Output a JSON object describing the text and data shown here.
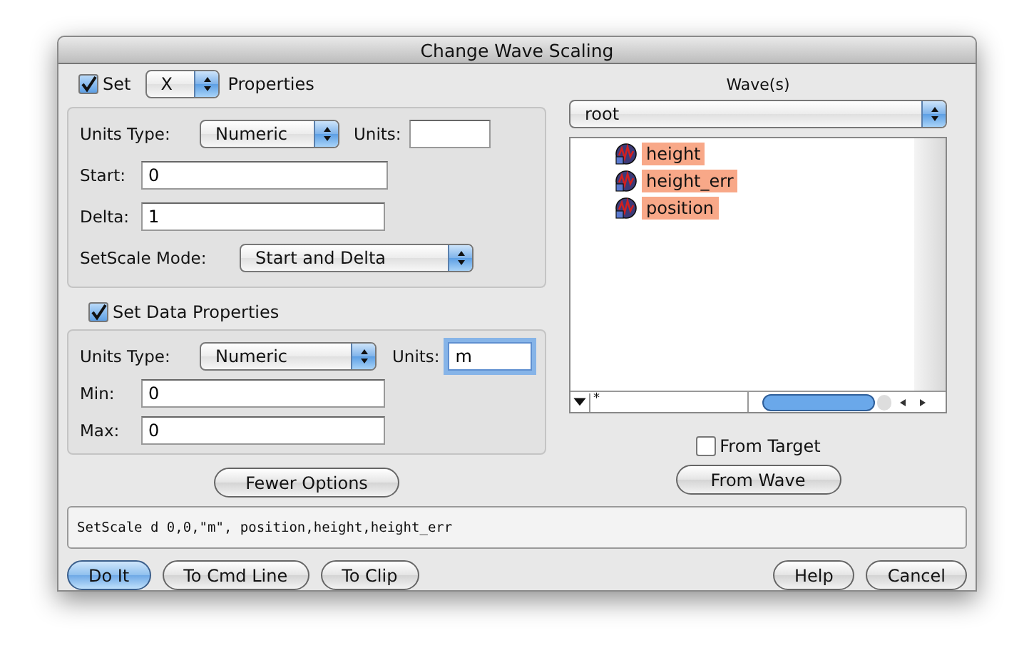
{
  "window": {
    "title": "Change Wave Scaling"
  },
  "axis": {
    "checked": true,
    "label": "Set",
    "axis": "X",
    "suffix": "Properties",
    "units_type_label": "Units Type:",
    "units_type": "Numeric",
    "units_label": "Units:",
    "start_label": "Start:",
    "start": "0",
    "delta_label": "Delta:",
    "delta": "1",
    "mode_label": "SetScale Mode:",
    "mode": "Start and Delta"
  },
  "data": {
    "checked": true,
    "label": "Set Data Properties",
    "units_type_label": "Units Type:",
    "units_type": "Numeric",
    "units_label": "Units:",
    "units": "m",
    "units_focused": true,
    "min_label": "Min:",
    "min": "0",
    "max_label": "Max:",
    "max": "0"
  },
  "fewer_options": "Fewer Options",
  "waves": {
    "label": "Wave(s)",
    "folder": "root",
    "items": [
      {
        "name": "height",
        "selected": true
      },
      {
        "name": "height_err",
        "selected": true
      },
      {
        "name": "position",
        "selected": true
      }
    ],
    "filter": "*"
  },
  "from_target": {
    "label": "From Target",
    "checked": false
  },
  "from_wave": "From Wave",
  "command": "SetScale d 0,0,\"m\", position,height,height_err",
  "left_buttons": [
    {
      "label": "Do It",
      "default": true
    },
    {
      "label": "To Cmd Line",
      "default": false
    },
    {
      "label": "To Clip",
      "default": false
    }
  ],
  "right_buttons": [
    {
      "label": "Help",
      "default": false
    },
    {
      "label": "Cancel",
      "default": false
    }
  ]
}
